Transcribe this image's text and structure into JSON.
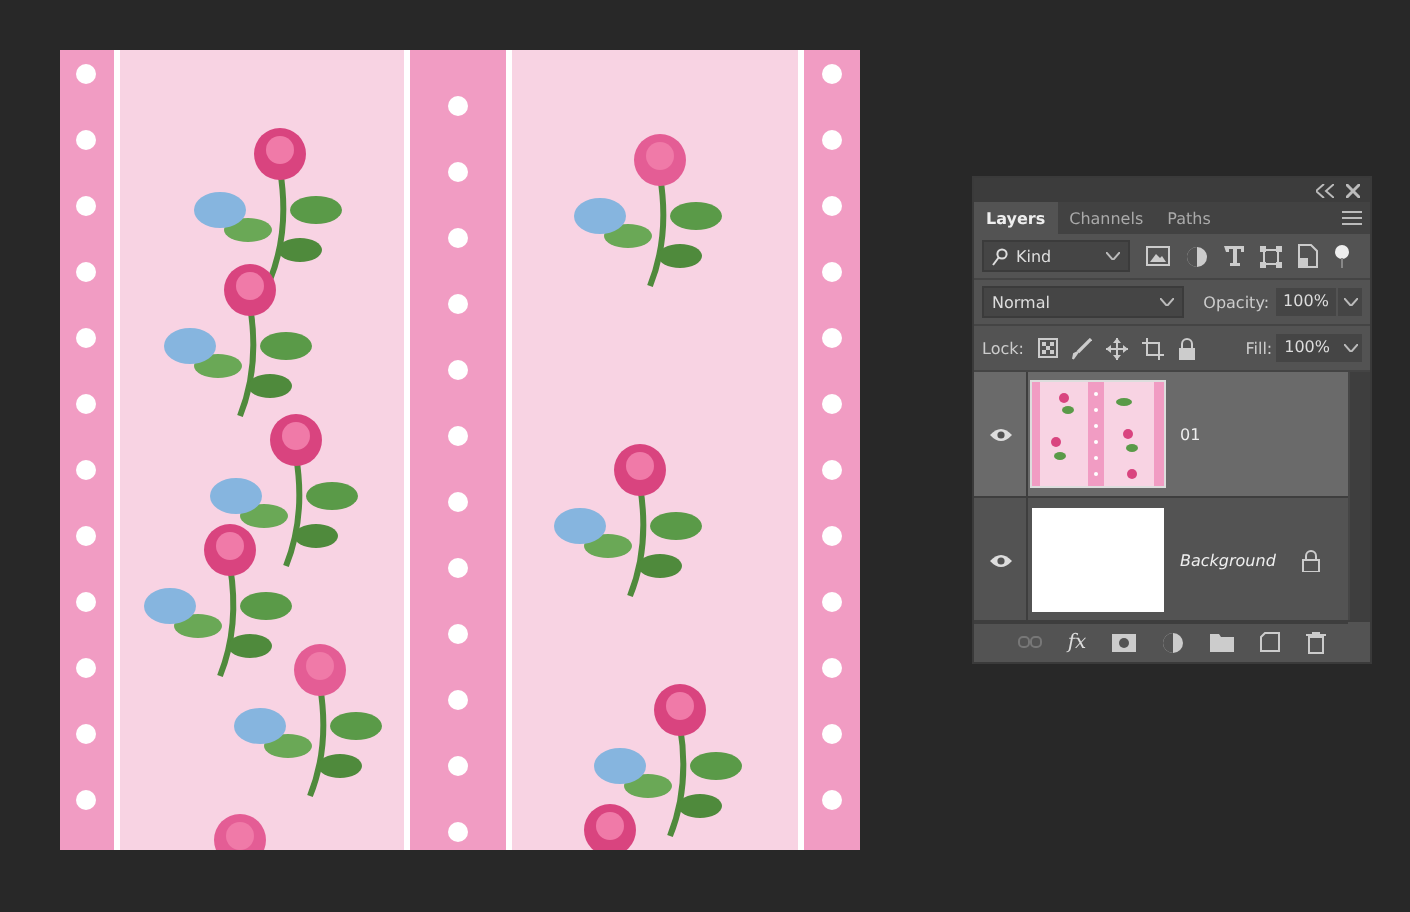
{
  "layers_panel": {
    "tabs": [
      {
        "label": "Layers",
        "selected": true
      },
      {
        "label": "Channels",
        "selected": false
      },
      {
        "label": "Paths",
        "selected": false
      }
    ],
    "filter": {
      "value": "Kind"
    },
    "blend_mode": {
      "value": "Normal"
    },
    "opacity": {
      "label": "Opacity:",
      "value": "100%"
    },
    "lock": {
      "label": "Lock:"
    },
    "fill": {
      "label": "Fill:",
      "value": "100%"
    },
    "layers": [
      {
        "name": "01",
        "kind": "pattern",
        "selected": true,
        "visible": true,
        "locked": false
      },
      {
        "name": "Background",
        "kind": "background",
        "selected": false,
        "visible": true,
        "locked": true
      }
    ],
    "footer_fx": "fx"
  }
}
